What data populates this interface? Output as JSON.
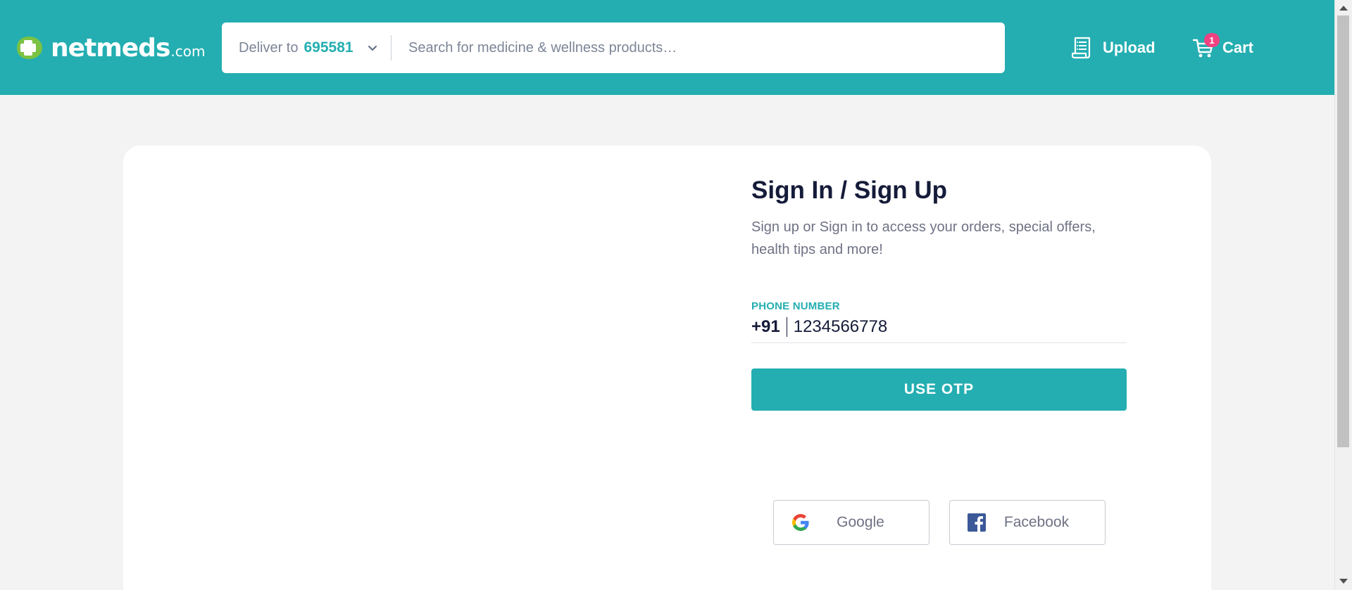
{
  "header": {
    "logo": {
      "brand": "netmeds",
      "suffix": ".com"
    },
    "deliver": {
      "label": "Deliver to",
      "pincode": "695581"
    },
    "search": {
      "placeholder": "Search for medicine & wellness products…"
    },
    "upload": {
      "label": "Upload",
      "icon": "prescription-icon"
    },
    "cart": {
      "label": "Cart",
      "badge_count": "1",
      "icon": "cart-icon"
    },
    "colors": {
      "background": "#24aeb1",
      "badge": "#ef4281"
    }
  },
  "login": {
    "title": "Sign In / Sign Up",
    "subtitle": "Sign up or Sign in to access your orders, special offers, health tips and more!",
    "phone_label": "PHONE NUMBER",
    "country_code": "+91",
    "phone_value": "1234566778",
    "otp_button": "USE OTP"
  },
  "social": [
    {
      "label": "Google",
      "icon": "google-icon"
    },
    {
      "label": "Facebook",
      "icon": "facebook-icon"
    }
  ]
}
